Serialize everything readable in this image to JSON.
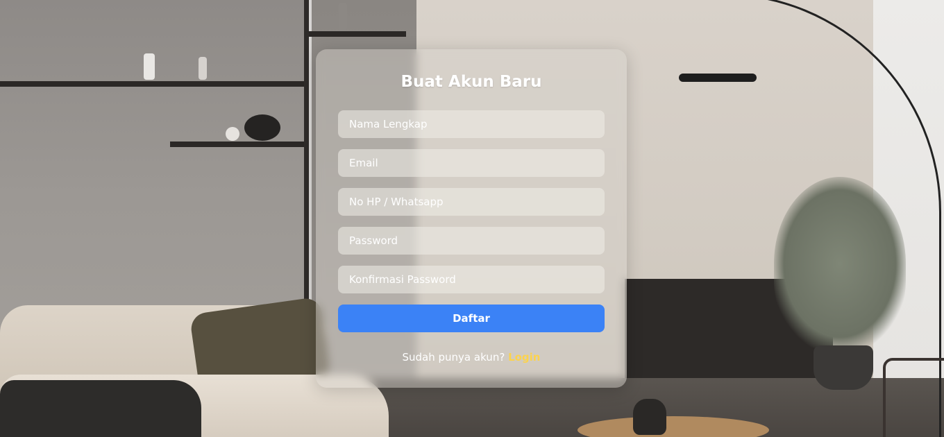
{
  "form": {
    "title": "Buat Akun Baru",
    "fields": [
      {
        "placeholder": "Nama Lengkap"
      },
      {
        "placeholder": "Email"
      },
      {
        "placeholder": "No HP / Whatsapp"
      },
      {
        "placeholder": "Password"
      },
      {
        "placeholder": "Konfirmasi Password"
      }
    ],
    "submit_label": "Daftar",
    "footer_text": "Sudah punya akun?",
    "login_link": "Login"
  },
  "colors": {
    "button": "#3b82f6",
    "link": "#fcd34d"
  }
}
